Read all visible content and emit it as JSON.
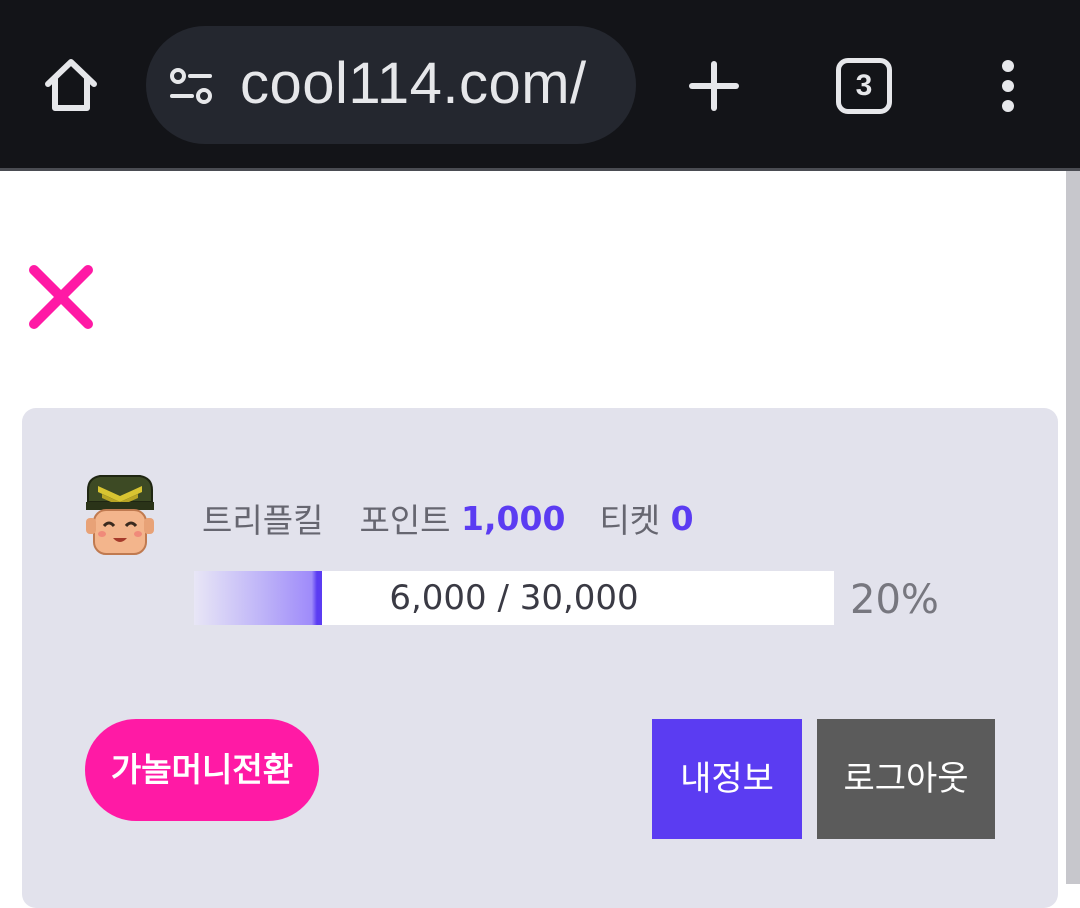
{
  "browser": {
    "url": "cool114.com/",
    "tab_count": "3"
  },
  "user": {
    "name": "트리플킬",
    "points_label": "포인트",
    "points_value": "1,000",
    "tickets_label": "티켓",
    "tickets_value": "0"
  },
  "progress": {
    "text": "6,000 / 30,000",
    "percent_text": "20%",
    "fraction": 0.2
  },
  "buttons": {
    "convert": "가놀머니전환",
    "my_info": "내정보",
    "logout": "로그아웃"
  },
  "colors": {
    "accent_purple": "#5b3cf2",
    "accent_pink": "#ff1aa5",
    "panel_bg": "#e2e2ec",
    "logout_gray": "#5b5b5b"
  }
}
